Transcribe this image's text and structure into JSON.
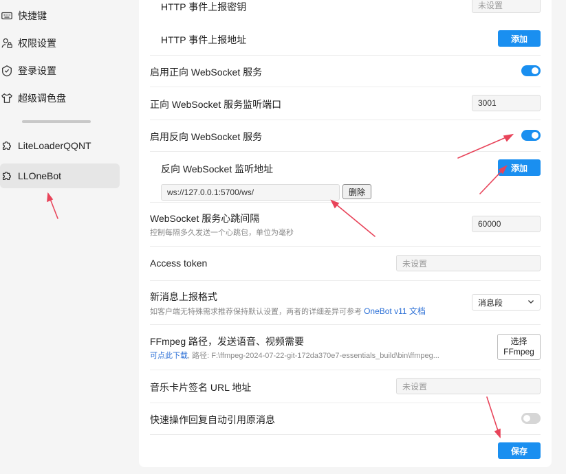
{
  "sidebar": {
    "items": [
      {
        "label": "快捷键",
        "icon": "keyboard-icon"
      },
      {
        "label": "权限设置",
        "icon": "user-lock-icon"
      },
      {
        "label": "登录设置",
        "icon": "shield-icon"
      },
      {
        "label": "超级调色盘",
        "icon": "shirt-icon"
      },
      {
        "label": "LiteLoaderQQNT",
        "icon": "puzzle-icon"
      },
      {
        "label": "LLOneBot",
        "icon": "puzzle-icon"
      }
    ]
  },
  "settings": {
    "http_secret": {
      "label": "HTTP 事件上报密钥",
      "placeholder": "未设置"
    },
    "http_url": {
      "label": "HTTP 事件上报地址",
      "button": "添加"
    },
    "ws_enable": {
      "label": "启用正向 WebSocket 服务",
      "on": true
    },
    "ws_port": {
      "label": "正向 WebSocket 服务监听端口",
      "value": "3001"
    },
    "rws_enable": {
      "label": "启用反向 WebSocket 服务",
      "on": true
    },
    "rws_url": {
      "label": "反向 WebSocket 监听地址",
      "button": "添加",
      "entry": "ws://127.0.0.1:5700/ws/",
      "delete": "删除"
    },
    "heartbeat": {
      "label": "WebSocket 服务心跳间隔",
      "desc": "控制每隔多久发送一个心跳包，单位为毫秒",
      "value": "60000"
    },
    "token": {
      "label": "Access token",
      "placeholder": "未设置"
    },
    "msg_format": {
      "label": "新消息上报格式",
      "desc": "如客户端无特殊需求推荐保持默认设置，两者的详细差异可参考",
      "link": "OneBot v11 文档",
      "value": "消息段"
    },
    "ffmpeg": {
      "label": "FFmpeg 路径，发送语音、视频需要",
      "link": "可点此下载",
      "path": ", 路径: F:\\ffmpeg-2024-07-22-git-172da370e7-essentials_build\\bin\\ffmpeg...",
      "button_line1": "选择",
      "button_line2": "FFmpeg"
    },
    "music": {
      "label": "音乐卡片签名 URL 地址",
      "placeholder": "未设置"
    },
    "quick_reply": {
      "label": "快速操作回复自动引用原消息",
      "on": false
    }
  },
  "save_label": "保存",
  "colors": {
    "accent": "#1a8ff0",
    "annotation": "#e8445a"
  }
}
